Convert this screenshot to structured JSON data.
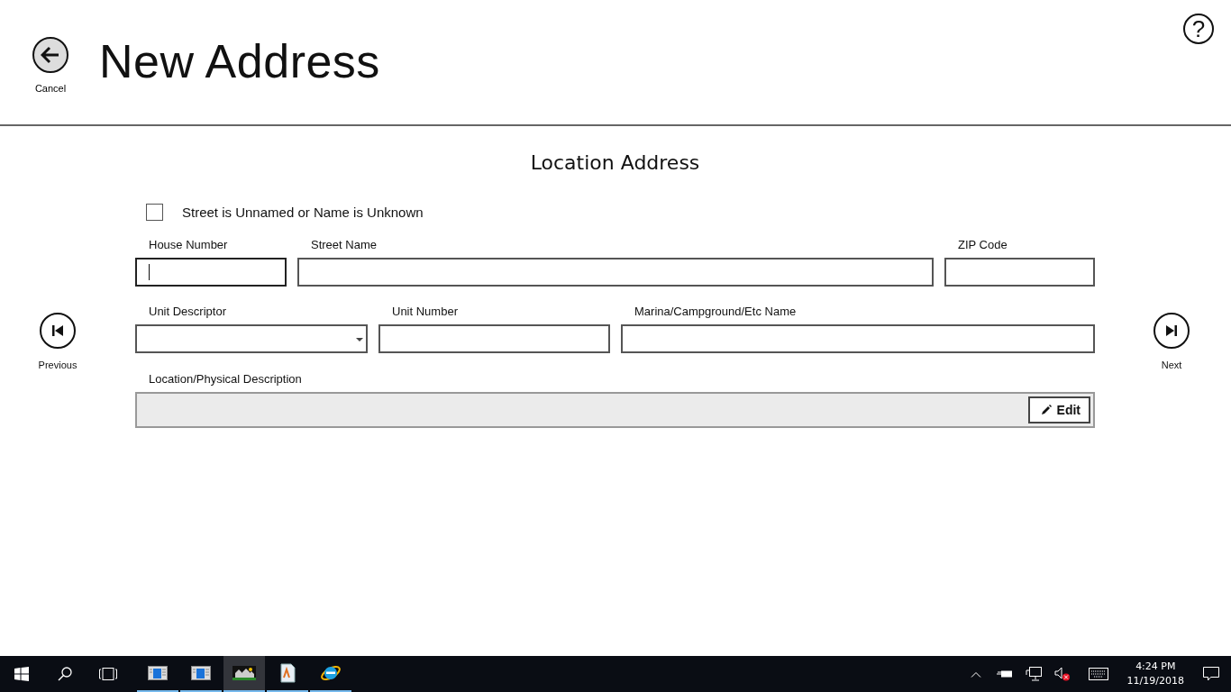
{
  "header": {
    "back_label": "Cancel",
    "title": "New Address",
    "help": "?"
  },
  "form": {
    "heading": "Location Address",
    "checkbox": {
      "label": "Street is Unnamed or Name is Unknown",
      "checked": false
    },
    "rows": [
      [
        {
          "kind": "text",
          "label": "House Number",
          "focused": true
        },
        {
          "kind": "text",
          "label": "Street Name",
          "focused": false
        },
        {
          "kind": "text",
          "label": "ZIP Code",
          "focused": false
        }
      ],
      [
        {
          "kind": "dropdown",
          "label": "Unit Descriptor",
          "focused": false
        },
        {
          "kind": "text",
          "label": "Unit Number",
          "focused": false
        },
        {
          "kind": "text",
          "label": "Marina/Campground/Etc Name",
          "focused": false
        }
      ]
    ],
    "description": {
      "label": "Location/Physical Description",
      "button": "Edit"
    }
  },
  "nav": {
    "previous": "Previous",
    "next": "Next"
  },
  "taskbar": {
    "apps": [
      {
        "kind": "window",
        "active": false
      },
      {
        "kind": "window",
        "active": false
      },
      {
        "kind": "houses",
        "active": true
      },
      {
        "kind": "document",
        "active": false
      },
      {
        "kind": "browser",
        "active": false
      }
    ],
    "time": "4:24 PM",
    "date": "11/19/2018"
  }
}
